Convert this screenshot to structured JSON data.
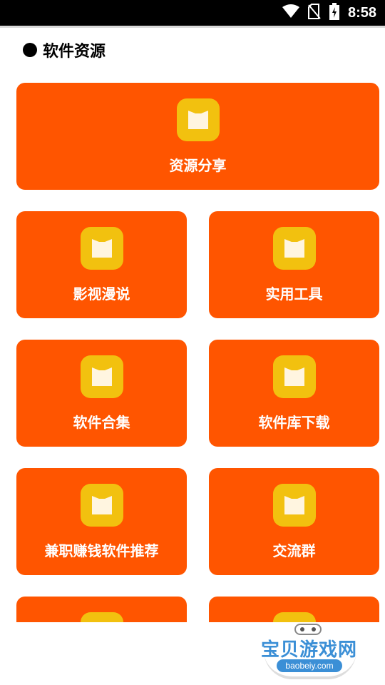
{
  "status_bar": {
    "time": "8:58",
    "icons": [
      "wifi-icon",
      "no-sim-icon",
      "battery-charging-icon"
    ]
  },
  "section": {
    "title": "软件资源"
  },
  "cards": [
    {
      "label": "资源分享",
      "icon": "folder-icon"
    },
    {
      "label": "影视漫说",
      "icon": "folder-icon"
    },
    {
      "label": "实用工具",
      "icon": "folder-icon"
    },
    {
      "label": "软件合集",
      "icon": "folder-icon"
    },
    {
      "label": "软件库下载",
      "icon": "folder-icon"
    },
    {
      "label": "兼职赚钱软件推荐",
      "icon": "folder-icon"
    },
    {
      "label": "交流群",
      "icon": "folder-icon"
    },
    {
      "label": "",
      "icon": "folder-icon"
    },
    {
      "label": "",
      "icon": "folder-icon"
    }
  ],
  "watermark": {
    "title": "宝贝游戏网",
    "url": "baobeiy.com"
  },
  "colors": {
    "card": "#ff5500",
    "icon_bg": "#f2c10f",
    "status_bar": "#000000"
  }
}
